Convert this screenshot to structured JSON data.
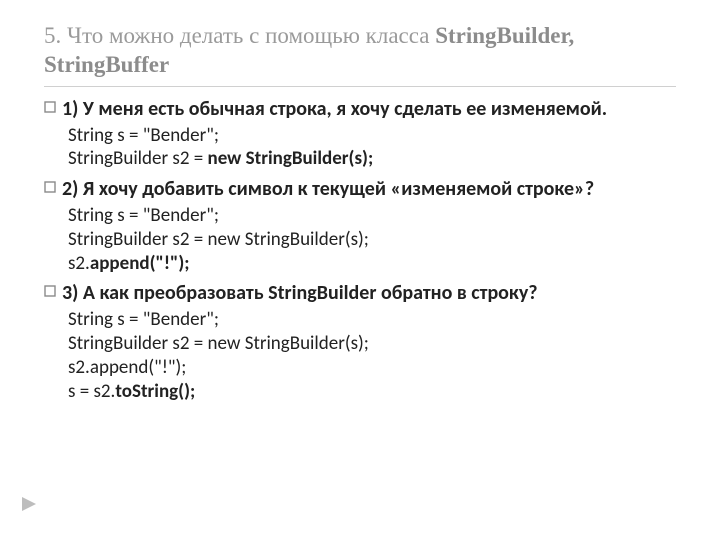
{
  "title": {
    "prefix": "5. Что можно делать с помощью класса ",
    "bold": "StringBuilder, StringBuffer"
  },
  "items": [
    {
      "heading": "1) У меня есть обычная строка, я хочу сделать ее изменяемой.",
      "code": [
        {
          "segments": [
            {
              "t": "String s = \"Bender\";"
            }
          ]
        },
        {
          "segments": [
            {
              "t": "StringBuilder s2 = "
            },
            {
              "t": "new StringBuilder(s);",
              "bold": true
            }
          ]
        }
      ]
    },
    {
      "heading": "2) Я хочу добавить символ к текущей «изменяемой строке»?",
      "code": [
        {
          "segments": [
            {
              "t": " String s = \"Bender\";"
            }
          ]
        },
        {
          "segments": [
            {
              "t": "StringBuilder s2 = new StringBuilder(s);"
            }
          ]
        },
        {
          "segments": [
            {
              "t": "s2."
            },
            {
              "t": "append(\"!\");",
              "bold": true
            }
          ]
        }
      ]
    },
    {
      "heading": "3) А как преобразовать StringBuilder обратно в строку?",
      "code": [
        {
          "segments": [
            {
              "t": "String s = \"Bender\";"
            }
          ]
        },
        {
          "segments": [
            {
              "t": "StringBuilder s2 = new StringBuilder(s);"
            }
          ]
        },
        {
          "segments": [
            {
              "t": "s2.append(\"!\");"
            }
          ]
        },
        {
          "segments": [
            {
              "t": "s = s2."
            },
            {
              "t": "toString();",
              "bold": true
            }
          ]
        }
      ]
    }
  ]
}
